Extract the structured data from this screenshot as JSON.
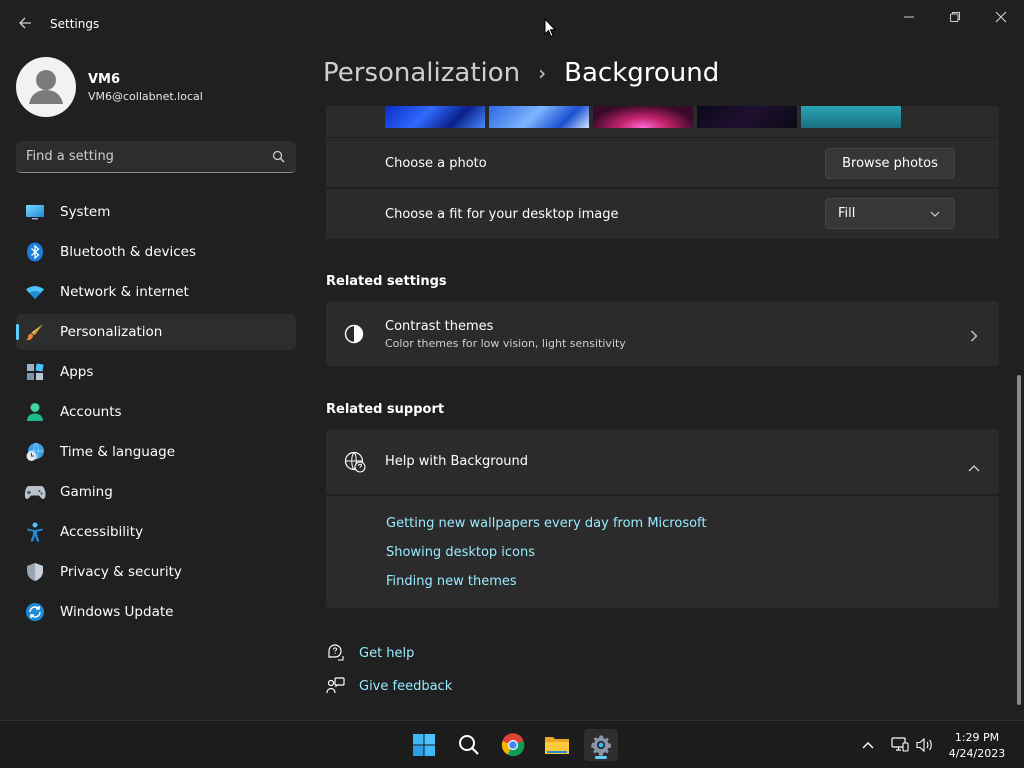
{
  "window": {
    "app_title": "Settings"
  },
  "profile": {
    "name": "VM6",
    "email": "VM6@collabnet.local"
  },
  "search": {
    "placeholder": "Find a setting"
  },
  "sidebar": {
    "items": [
      {
        "label": "System",
        "icon": "monitor-icon"
      },
      {
        "label": "Bluetooth & devices",
        "icon": "bluetooth-icon"
      },
      {
        "label": "Network & internet",
        "icon": "wifi-icon"
      },
      {
        "label": "Personalization",
        "icon": "brush-icon",
        "active": true
      },
      {
        "label": "Apps",
        "icon": "apps-icon"
      },
      {
        "label": "Accounts",
        "icon": "person-icon"
      },
      {
        "label": "Time & language",
        "icon": "globe-clock-icon"
      },
      {
        "label": "Gaming",
        "icon": "gamepad-icon"
      },
      {
        "label": "Accessibility",
        "icon": "accessibility-icon"
      },
      {
        "label": "Privacy & security",
        "icon": "shield-icon"
      },
      {
        "label": "Windows Update",
        "icon": "update-icon"
      }
    ]
  },
  "breadcrumb": {
    "parent": "Personalization",
    "separator": "›",
    "current": "Background"
  },
  "background": {
    "choose_photo_label": "Choose a photo",
    "browse_button": "Browse photos",
    "fit_label": "Choose a fit for your desktop image",
    "fit_value": "Fill"
  },
  "related_settings": {
    "title": "Related settings",
    "contrast_title": "Contrast themes",
    "contrast_subtitle": "Color themes for low vision, light sensitivity"
  },
  "related_support": {
    "title": "Related support",
    "help_title": "Help with Background",
    "links": [
      "Getting new wallpapers every day from Microsoft",
      "Showing desktop icons",
      "Finding new themes"
    ]
  },
  "footer": {
    "get_help": "Get help",
    "give_feedback": "Give feedback"
  },
  "taskbar": {
    "time": "1:29 PM",
    "date": "4/24/2023"
  },
  "colors": {
    "background": "#202020",
    "card": "#2b2b2b",
    "accent": "#60cdff",
    "link": "#99ebff"
  }
}
